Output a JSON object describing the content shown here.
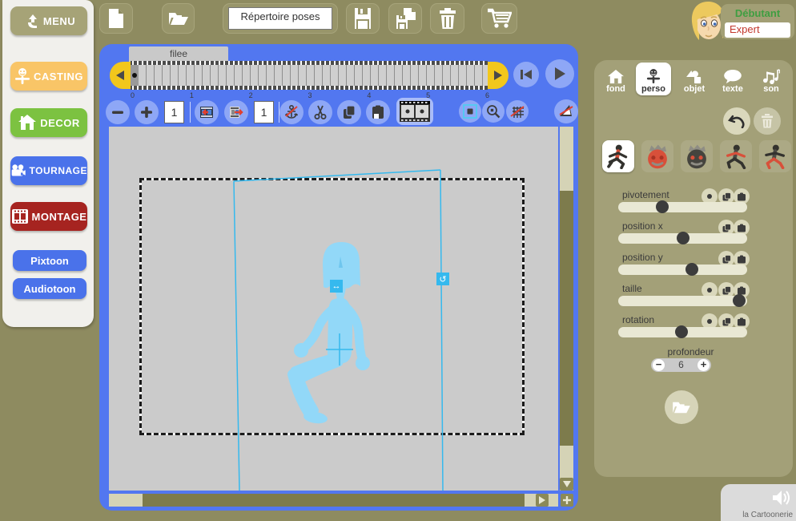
{
  "header": {
    "repertoire_label": "Répertoire poses",
    "level": {
      "beginner": "Débutant",
      "expert": "Expert"
    }
  },
  "sidebar": {
    "items": [
      {
        "label": "MENU"
      },
      {
        "label": "CASTING"
      },
      {
        "label": "DECOR"
      },
      {
        "label": "TOURNAGE"
      },
      {
        "label": "MONTAGE"
      },
      {
        "label": "Pixtoon"
      },
      {
        "label": "Audiotoon"
      }
    ]
  },
  "stage": {
    "timeline_tab": "filee",
    "ticks": [
      "0",
      "1",
      "2",
      "3",
      "4",
      "5",
      "6"
    ],
    "insert_frames_value": "1",
    "frame_count_value": "1"
  },
  "inspector": {
    "tabs": [
      {
        "label": "fond"
      },
      {
        "label": "perso"
      },
      {
        "label": "objet"
      },
      {
        "label": "texte"
      },
      {
        "label": "son"
      }
    ],
    "sliders": [
      {
        "label": "pivotement",
        "percent": 34
      },
      {
        "label": "position x",
        "percent": 50
      },
      {
        "label": "position y",
        "percent": 57
      },
      {
        "label": "taille",
        "percent": 94
      },
      {
        "label": "rotation",
        "percent": 49
      }
    ],
    "depth": {
      "label": "profondeur",
      "value": "6",
      "decrease": "−",
      "increase": "+"
    }
  },
  "footer": {
    "brand": "la Cartoonerie"
  },
  "colors": {
    "background": "#8e8b60",
    "stage_blue": "#5277f0",
    "button_blue": "#8ea7f6",
    "selection_cyan": "#35b9ee",
    "character_blue": "#92d8f8",
    "accent_yellow": "#f2c71c",
    "casting_orange": "#f9c567",
    "decor_green": "#7cc241",
    "tournage_blue": "#4a72ea",
    "montage_red": "#a62420",
    "beginner_green": "#3f9e41",
    "expert_red": "#c2372c"
  }
}
